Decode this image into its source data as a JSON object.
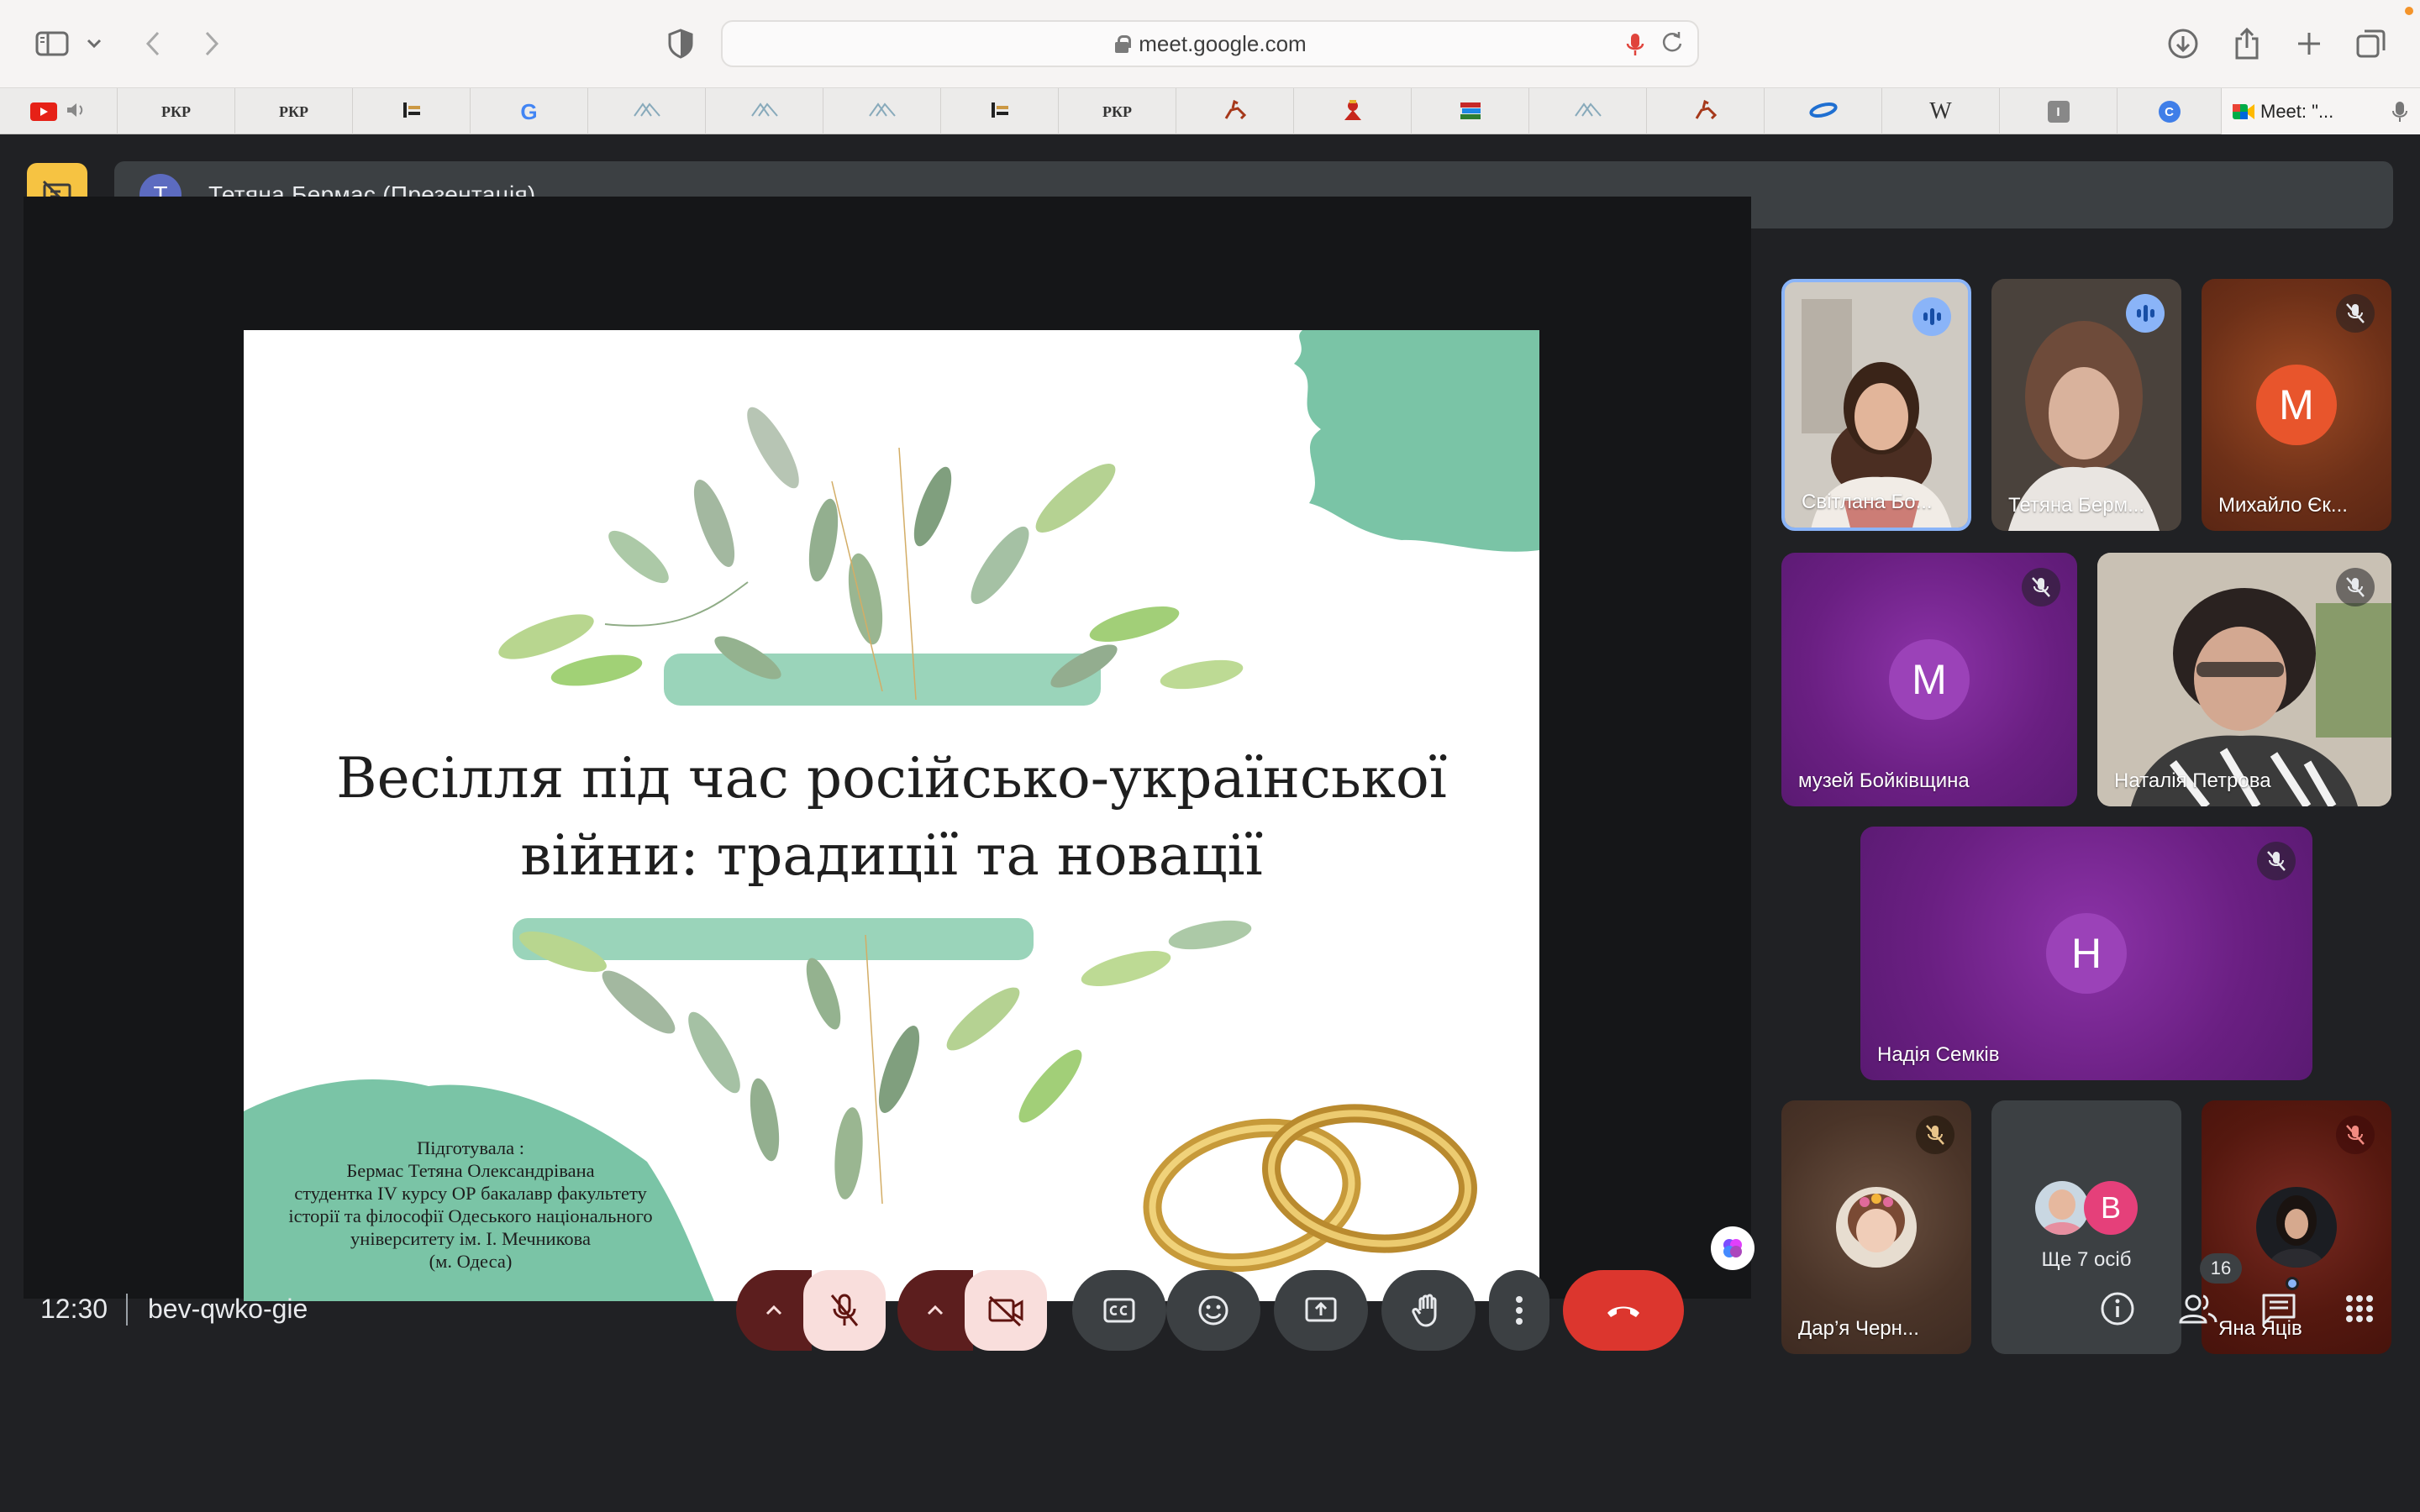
{
  "browser": {
    "url": "meet.google.com",
    "active_tab_label": "Meet: \"...",
    "tabs": [
      "youtube-favicon",
      "rkp-favicon",
      "rkp-favicon",
      "bookmark-favicon",
      "google-favicon",
      "library-favicon",
      "library-favicon",
      "library-favicon",
      "bookmark-favicon",
      "rkp-favicon",
      "rider-favicon",
      "cossack-favicon",
      "books-favicon",
      "library-favicon",
      "rider-favicon",
      "swoosh-favicon",
      "wikipedia-favicon",
      "i-favicon",
      "c-favicon"
    ],
    "tab_texts": {
      "rkp": "РКР",
      "wiki": "W",
      "i": "I",
      "c": "C",
      "g": "G"
    }
  },
  "meet": {
    "presenter_initial": "Т",
    "presenter_label": "Тетяна Бермас (Презентація)",
    "slide": {
      "title_line1": "Весілля під час російсько-української",
      "title_line2": "війни: традиції та новації",
      "credits": [
        "Підготувала :",
        "Бермас Тетяна Олександрівана",
        "студентка IV курсу ОР бакалавр факультету",
        "історії та філософії Одеського національного",
        "університету ім. І. Мечникова",
        "(м. Одеса)"
      ]
    },
    "participants": [
      {
        "name": "Світлана Бо...",
        "state": "speaking",
        "video": true
      },
      {
        "name": "Тетяна Берм...",
        "state": "speaking",
        "video": true
      },
      {
        "name": "Михайло Єк...",
        "initial": "М",
        "state": "muted",
        "video": false
      },
      {
        "name": "музей Бойківщина",
        "initial": "М",
        "state": "muted",
        "video": false
      },
      {
        "name": "Наталія Петрова",
        "state": "muted",
        "video": true
      },
      {
        "name": "Надія Семків",
        "initial": "Н",
        "state": "muted",
        "video": false
      },
      {
        "name": "Дар’я Черн...",
        "state": "muted",
        "video": true
      },
      {
        "name": "Ще 7 осіб",
        "initial": "В",
        "state": "group",
        "video": false
      },
      {
        "name": "Яна Яців",
        "state": "muted",
        "video": true
      }
    ],
    "bottom_bar": {
      "time": "12:30",
      "meeting_code": "bev-qwko-gie",
      "participant_count": "16"
    },
    "colors": {
      "background": "#202124",
      "present_yellow": "#f6c342",
      "hangup_red": "#dc362e",
      "speaking_blue": "#8ab4f8"
    }
  }
}
